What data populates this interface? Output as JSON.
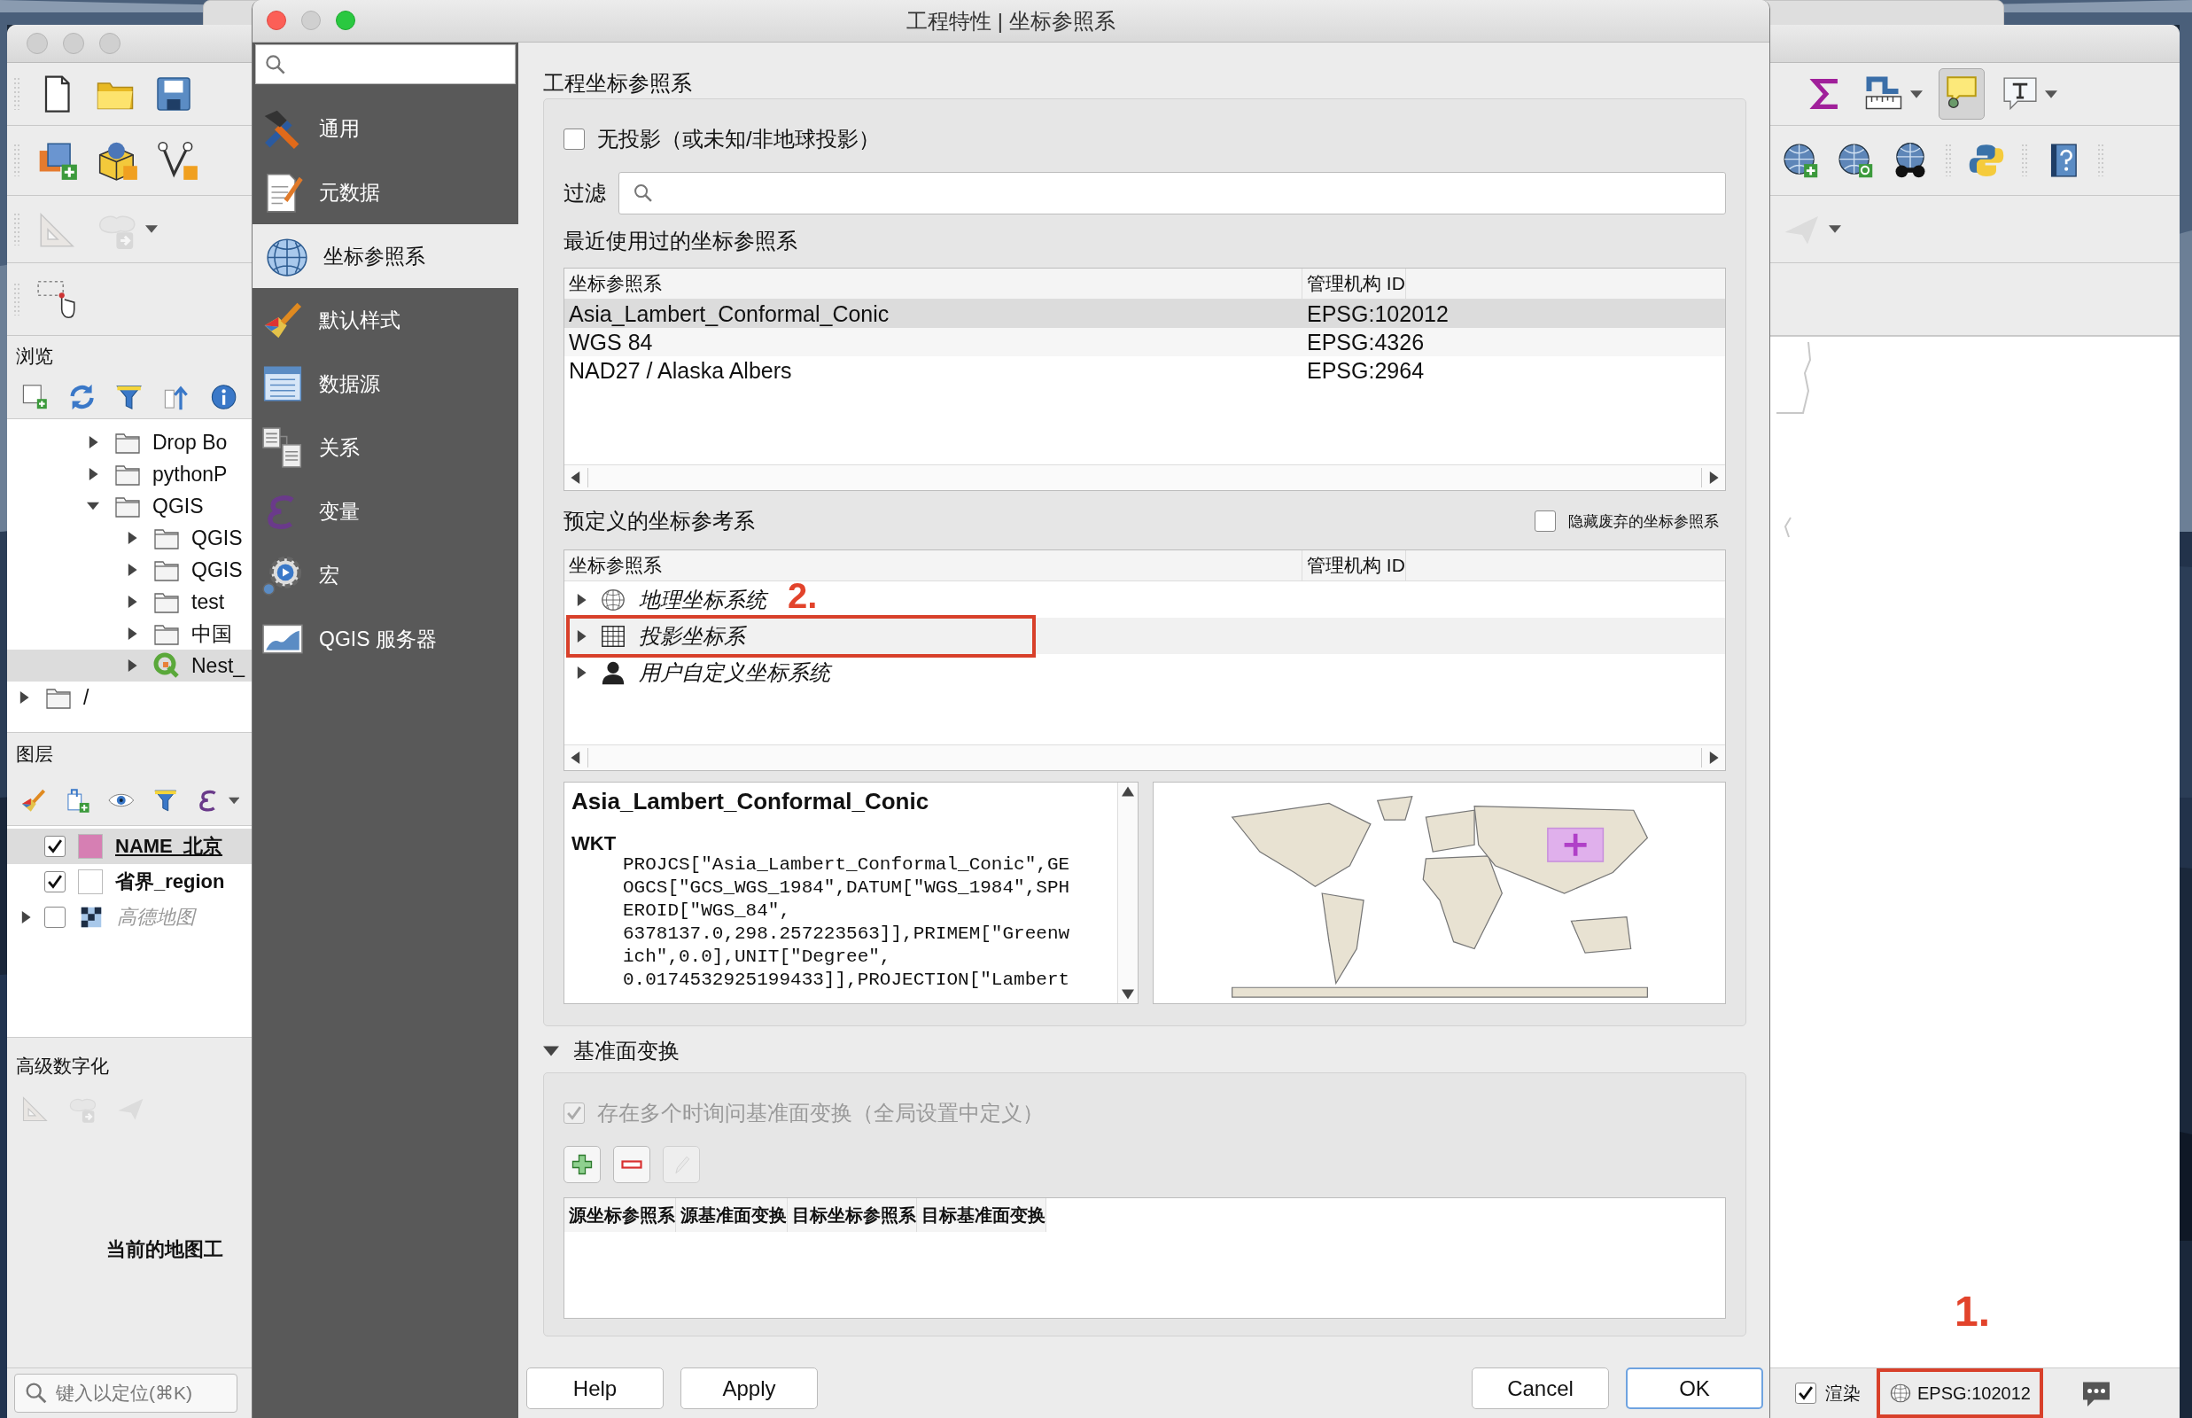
{
  "main_window": {
    "map_tips_active": true,
    "browser": {
      "title": "浏览",
      "tree": [
        {
          "children": [
            {
              "label": "Drop Bo",
              "kind": "folder",
              "expanded": false,
              "selected": false
            },
            {
              "label": "pythonP",
              "kind": "folder",
              "expanded": false,
              "selected": false
            },
            {
              "label": "QGIS",
              "kind": "folder",
              "expanded": true,
              "selected": false,
              "children": [
                {
                  "label": "QGIS",
                  "kind": "folder",
                  "expanded": false,
                  "selected": false
                },
                {
                  "label": "QGIS",
                  "kind": "folder",
                  "expanded": false,
                  "selected": false
                },
                {
                  "label": "test",
                  "kind": "folder",
                  "expanded": false,
                  "selected": false
                },
                {
                  "label": "中国",
                  "kind": "folder",
                  "expanded": false,
                  "selected": false
                },
                {
                  "label": "Nest_",
                  "kind": "project",
                  "expanded": false,
                  "selected": true
                }
              ]
            }
          ]
        },
        {
          "label": "/",
          "kind": "folder",
          "expanded": false,
          "selected": false
        }
      ]
    },
    "layers": {
      "title": "图层",
      "items": [
        {
          "label": "NAME_北京",
          "kind": "vector",
          "color": "#d67fb3",
          "checked": true,
          "selected": true
        },
        {
          "label": "省界_region",
          "kind": "vector",
          "color": "#ffffff",
          "checked": true,
          "selected": false
        },
        {
          "label": "高德地图",
          "kind": "raster",
          "checked": false,
          "selected": false,
          "expanded": false
        }
      ]
    },
    "digitizing": {
      "title": "高级数字化",
      "message": "当前的地图工"
    },
    "locator": {
      "placeholder": "键入以定位(⌘K)"
    },
    "status": {
      "render": {
        "label": "渲染",
        "checked": true
      },
      "crs": {
        "label": "EPSG:102012",
        "annotation": "1."
      }
    }
  },
  "dialog": {
    "title": "工程特性 | 坐标参照系",
    "nav": [
      {
        "label": "通用",
        "selected": false
      },
      {
        "label": "元数据",
        "selected": false
      },
      {
        "label": "坐标参照系",
        "selected": true
      },
      {
        "label": "默认样式",
        "selected": false
      },
      {
        "label": "数据源",
        "selected": false
      },
      {
        "label": "关系",
        "selected": false
      },
      {
        "label": "变量",
        "selected": false
      },
      {
        "label": "宏",
        "selected": false
      },
      {
        "label": "QGIS 服务器",
        "selected": false
      }
    ],
    "project_crs": {
      "title": "工程坐标参照系",
      "no_projection": {
        "label": "无投影（或未知/非地球投影）",
        "checked": false
      },
      "filter_label": "过滤",
      "recent": {
        "title": "最近使用过的坐标参照系",
        "columns": [
          "坐标参照系",
          "管理机构 ID"
        ],
        "rows": [
          {
            "name": "Asia_Lambert_Conformal_Conic",
            "authority_id": "EPSG:102012",
            "selected": true
          },
          {
            "name": "WGS 84",
            "authority_id": "EPSG:4326",
            "selected": false
          },
          {
            "name": "NAD27 / Alaska Albers",
            "authority_id": "EPSG:2964",
            "selected": false
          }
        ]
      },
      "predefined": {
        "title": "预定义的坐标参考系",
        "hide_deprecated": {
          "label": "隐藏废弃的坐标参照系",
          "checked": false
        },
        "columns": [
          "坐标参照系",
          "管理机构 ID"
        ],
        "rows": [
          {
            "kind": "geographic",
            "label": "地理坐标系统",
            "expanded": false,
            "selected": false
          },
          {
            "kind": "projected",
            "label": "投影坐标系",
            "expanded": false,
            "selected": true,
            "annotation": "2."
          },
          {
            "kind": "user",
            "label": "用户自定义坐标系统",
            "expanded": false,
            "selected": false
          }
        ]
      },
      "details": {
        "name": "Asia_Lambert_Conformal_Conic",
        "wkt_label": "WKT",
        "wkt_lines": [
          "PROJCS[\"Asia_Lambert_Conformal_Conic\",GE",
          "OGCS[\"GCS_WGS_1984\",DATUM[\"WGS_1984\",SPH",
          "EROID[\"WGS_84\",",
          "6378137.0,298.257223563]],PRIMEM[\"Greenw",
          "ich\",0.0],UNIT[\"Degree\",",
          "0.0174532925199433]],PROJECTION[\"Lambert"
        ]
      }
    },
    "datum": {
      "title": "基准面变换",
      "expanded": true,
      "ask": {
        "label": "存在多个时询问基准面变换（全局设置中定义）",
        "checked": true,
        "disabled": true
      },
      "edit_enabled": false,
      "columns": [
        "源坐标参照系",
        "源基准面变换",
        "目标坐标参照系",
        "目标基准面变换"
      ]
    },
    "buttons": [
      {
        "label": "Help",
        "default": false
      },
      {
        "label": "Apply",
        "default": false
      },
      {
        "label": "Cancel",
        "default": false
      },
      {
        "label": "OK",
        "default": true
      }
    ]
  }
}
